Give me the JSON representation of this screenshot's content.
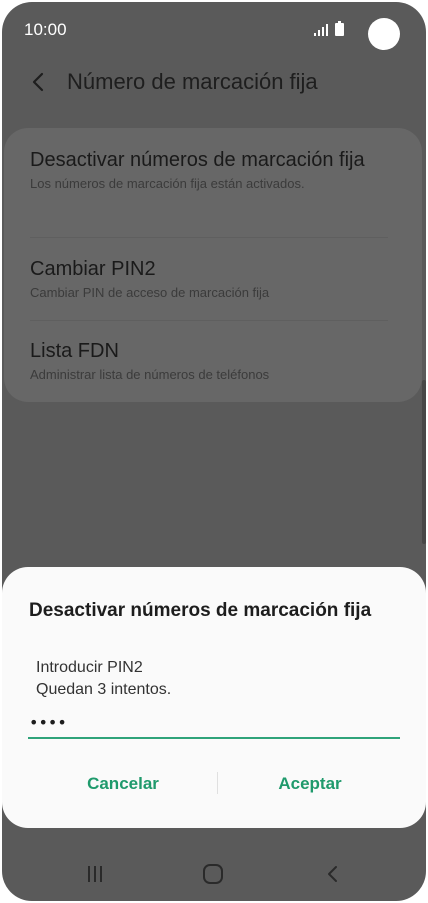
{
  "status_bar": {
    "time": "10:00"
  },
  "header": {
    "title": "Número de marcación fija"
  },
  "settings": {
    "items": [
      {
        "title": "Desactivar números de marcación fija",
        "subtitle": "Los números de marcación fija están activados."
      },
      {
        "title": "Cambiar PIN2",
        "subtitle": "Cambiar PIN de acceso de marcación fija"
      },
      {
        "title": "Lista FDN",
        "subtitle": "Administrar lista de números de teléfonos"
      }
    ]
  },
  "dialog": {
    "title": "Desactivar números de marcación fija",
    "message_line1": "Introducir PIN2",
    "message_line2": "Quedan 3 intentos.",
    "pin_value": "••••",
    "cancel_label": "Cancelar",
    "accept_label": "Aceptar"
  },
  "colors": {
    "accent": "#1f9a6c",
    "input_underline": "#2fa37a",
    "dim_background": "#5a5a5a",
    "dialog_background": "#fafafa"
  },
  "icons": {
    "status": [
      "signal-icon",
      "battery-icon",
      "camera-icon"
    ],
    "appbar": [
      "back-icon"
    ],
    "navigation": [
      "recents-icon",
      "home-icon",
      "back-icon"
    ]
  }
}
